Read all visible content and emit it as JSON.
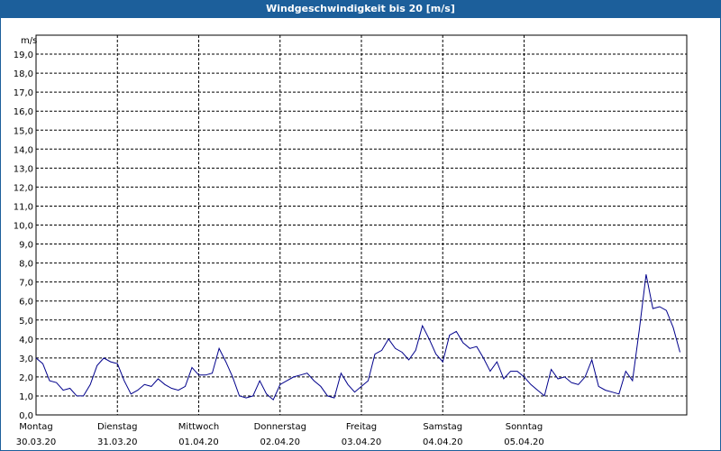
{
  "title": "Windgeschwindigkeit bis 20 [m/s]",
  "chart_data": {
    "type": "line",
    "title": "Windgeschwindigkeit bis 20 [m/s]",
    "ylabel": "m/s",
    "ylim": [
      0,
      20
    ],
    "xlim": [
      "2020-03-30 00:00",
      "2020-04-07 00:00"
    ],
    "yticks": [
      "0,0",
      "1,0",
      "2,0",
      "3,0",
      "4,0",
      "5,0",
      "6,0",
      "7,0",
      "8,0",
      "9,0",
      "10,0",
      "11,0",
      "12,0",
      "13,0",
      "14,0",
      "15,0",
      "16,0",
      "17,0",
      "18,0",
      "19,0"
    ],
    "xticks": [
      {
        "day": "Montag",
        "date": "30.03.20"
      },
      {
        "day": "Dienstag",
        "date": "31.03.20"
      },
      {
        "day": "Mittwoch",
        "date": "01.04.20"
      },
      {
        "day": "Donnerstag",
        "date": "02.04.20"
      },
      {
        "day": "Freitag",
        "date": "03.04.20"
      },
      {
        "day": "Samstag",
        "date": "04.04.20"
      },
      {
        "day": "Sonntag",
        "date": "05.04.20"
      }
    ],
    "grid": true,
    "line_color": "#00008b",
    "series": [
      {
        "x": [
          "2020-03-30 00:00",
          "2020-03-30 02:00",
          "2020-03-30 04:00",
          "2020-03-30 06:00",
          "2020-03-30 08:00",
          "2020-03-30 10:00",
          "2020-03-30 12:00",
          "2020-03-30 14:00",
          "2020-03-30 16:00",
          "2020-03-30 18:00",
          "2020-03-30 20:00",
          "2020-03-30 22:00",
          "2020-03-31 00:00",
          "2020-03-31 02:00",
          "2020-03-31 04:00",
          "2020-03-31 06:00",
          "2020-03-31 08:00",
          "2020-03-31 10:00",
          "2020-03-31 12:00",
          "2020-03-31 14:00",
          "2020-03-31 16:00",
          "2020-03-31 18:00",
          "2020-03-31 20:00",
          "2020-03-31 22:00",
          "2020-04-01 00:00",
          "2020-04-01 02:00",
          "2020-04-01 04:00",
          "2020-04-01 06:00",
          "2020-04-01 08:00",
          "2020-04-01 10:00",
          "2020-04-01 12:00",
          "2020-04-01 14:00",
          "2020-04-01 16:00",
          "2020-04-01 18:00",
          "2020-04-01 20:00",
          "2020-04-01 22:00",
          "2020-04-02 00:00",
          "2020-04-02 02:00",
          "2020-04-02 04:00",
          "2020-04-02 06:00",
          "2020-04-02 08:00",
          "2020-04-02 10:00",
          "2020-04-02 12:00",
          "2020-04-02 14:00",
          "2020-04-02 16:00",
          "2020-04-02 18:00",
          "2020-04-02 20:00",
          "2020-04-02 22:00",
          "2020-04-03 00:00",
          "2020-04-03 02:00",
          "2020-04-03 04:00",
          "2020-04-03 06:00",
          "2020-04-03 08:00",
          "2020-04-03 10:00",
          "2020-04-03 12:00",
          "2020-04-03 14:00",
          "2020-04-03 16:00",
          "2020-04-03 18:00",
          "2020-04-03 20:00",
          "2020-04-03 22:00",
          "2020-04-04 00:00",
          "2020-04-04 02:00",
          "2020-04-04 04:00",
          "2020-04-04 06:00",
          "2020-04-04 08:00",
          "2020-04-04 10:00",
          "2020-04-04 12:00",
          "2020-04-04 14:00",
          "2020-04-04 16:00",
          "2020-04-04 18:00",
          "2020-04-04 20:00",
          "2020-04-04 22:00",
          "2020-04-05 00:00",
          "2020-04-05 02:00",
          "2020-04-05 04:00",
          "2020-04-05 06:00",
          "2020-04-05 08:00",
          "2020-04-05 10:00",
          "2020-04-05 12:00",
          "2020-04-05 14:00",
          "2020-04-05 16:00",
          "2020-04-05 18:00",
          "2020-04-05 20:00",
          "2020-04-05 22:00",
          "2020-04-06 00:00",
          "2020-04-06 02:00",
          "2020-04-06 04:00",
          "2020-04-06 06:00",
          "2020-04-06 08:00",
          "2020-04-06 10:00",
          "2020-04-06 12:00",
          "2020-04-06 14:00",
          "2020-04-06 16:00",
          "2020-04-06 18:00",
          "2020-04-06 20:00",
          "2020-04-06 22:00"
        ],
        "y": [
          3.0,
          2.7,
          1.8,
          1.7,
          1.3,
          1.4,
          1.0,
          1.0,
          1.6,
          2.6,
          3.0,
          2.8,
          2.7,
          1.8,
          1.1,
          1.3,
          1.6,
          1.5,
          1.9,
          1.6,
          1.4,
          1.3,
          1.5,
          2.5,
          2.1,
          2.1,
          2.2,
          3.5,
          2.8,
          2.0,
          1.0,
          0.9,
          1.0,
          1.8,
          1.1,
          0.8,
          1.6,
          1.8,
          2.0,
          2.1,
          2.2,
          1.8,
          1.5,
          1.0,
          0.9,
          2.2,
          1.6,
          1.2,
          1.5,
          1.8,
          3.2,
          3.4,
          4.0,
          3.5,
          3.3,
          2.9,
          3.4,
          4.7,
          4.0,
          3.2,
          2.8,
          4.2,
          4.4,
          3.8,
          3.5,
          3.6,
          3.0,
          2.3,
          2.8,
          1.9,
          2.3,
          2.3,
          2.0,
          1.6,
          1.3,
          1.0,
          2.4,
          1.9,
          2.0,
          1.7,
          1.6,
          2.0,
          2.9,
          1.5,
          1.3,
          1.2,
          1.1,
          2.3,
          1.8,
          4.5,
          7.4,
          5.6,
          5.7,
          5.5,
          4.6,
          3.3
        ]
      }
    ]
  }
}
